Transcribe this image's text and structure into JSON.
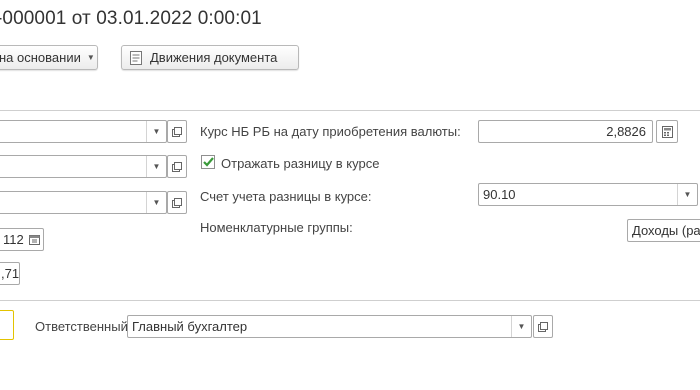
{
  "document": {
    "title": "-000001 от 03.01.2022 0:00:01"
  },
  "toolbar": {
    "create_based_on_label": "на основании",
    "document_movements_label": "Движения документа"
  },
  "form": {
    "left_partial": {
      "date_value": "112",
      "amount_value": ",71"
    },
    "rate_label": "Курс НБ РБ на дату приобретения валюты:",
    "rate_value": "2,8826",
    "reflect_difference_label": "Отражать разницу в курсе",
    "reflect_difference_checked": true,
    "difference_account_label": "Счет учета разницы в курсе:",
    "difference_account_value": "90.10",
    "nomenclature_groups_label": "Номенклатурные группы:",
    "nomenclature_groups_value": "Доходы (ра"
  },
  "footer": {
    "responsible_label": "Ответственный:",
    "responsible_value": "Главный бухгалтер"
  },
  "colors": {
    "accent_border": "#e3c300",
    "check_mark": "#3a9a3a"
  }
}
